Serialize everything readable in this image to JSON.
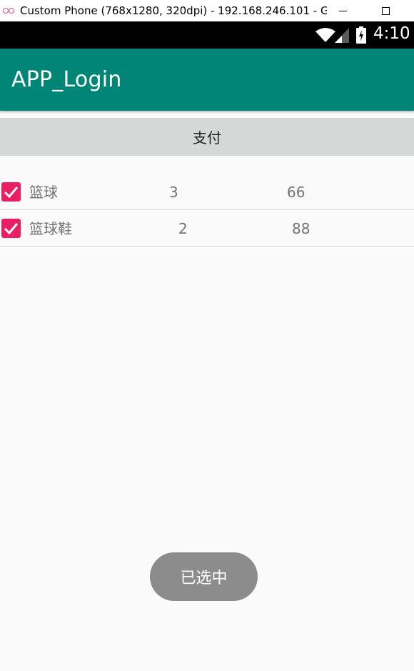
{
  "window": {
    "title": "Custom Phone (768x1280, 320dpi) - 192.168.246.101 - G..."
  },
  "status_bar": {
    "time": "4:10",
    "icons": [
      "wifi-icon",
      "signal-icon",
      "battery-icon"
    ]
  },
  "app_bar": {
    "title": "APP_Login",
    "color": "#008577"
  },
  "pay_button": {
    "label": "支付"
  },
  "items": [
    {
      "checked": true,
      "name": "篮球",
      "quantity": "3",
      "price": "66"
    },
    {
      "checked": true,
      "name": "篮球鞋",
      "quantity": "2",
      "price": "88"
    }
  ],
  "toast": {
    "text": "已选中"
  },
  "colors": {
    "accent": "#e91e63",
    "primary": "#008577",
    "button_bg": "#d6d7d7",
    "toast_bg": "#8c8c8c"
  }
}
